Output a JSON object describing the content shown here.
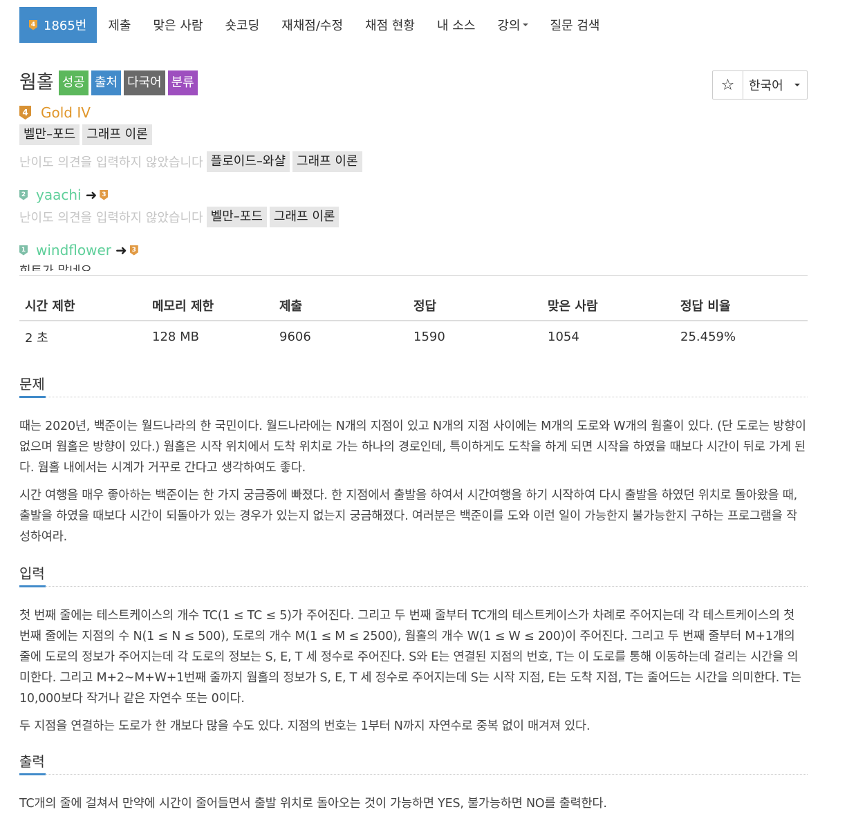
{
  "nav": {
    "problem_tier": "4",
    "problem_number": "1865번",
    "tabs": [
      "제출",
      "맞은 사람",
      "숏코딩",
      "재채점/수정",
      "채점 현황",
      "내 소스",
      "강의",
      "질문 검색"
    ]
  },
  "problem": {
    "title": "웜홀",
    "labels": [
      "성공",
      "출처",
      "다국어",
      "분류"
    ]
  },
  "controls": {
    "star_icon": "☆",
    "language": "한국어"
  },
  "tier": {
    "badge": "4",
    "name": "Gold IV"
  },
  "algorithm_tags": [
    "벨만–포드",
    "그래프 이론"
  ],
  "opinions": [
    {
      "difficulty_note": "난이도 의견을 입력하지 않았습니다",
      "tags": [
        "플로이드–와샬",
        "그래프 이론"
      ]
    },
    {
      "from_badge": "2",
      "user": "yaachi",
      "arrow": "➜",
      "to_badge": "3",
      "difficulty_note": "난이도 의견을 입력하지 않았습니다",
      "tags": [
        "벨만–포드",
        "그래프 이론"
      ]
    },
    {
      "from_badge": "1",
      "user": "windflower",
      "arrow": "➜",
      "to_badge": "3",
      "clipped_text": "힌트가 많네요"
    }
  ],
  "stats": {
    "headers": [
      "시간 제한",
      "메모리 제한",
      "제출",
      "정답",
      "맞은 사람",
      "정답 비율"
    ],
    "values": [
      "2 초",
      "128 MB",
      "9606",
      "1590",
      "1054",
      "25.459%"
    ]
  },
  "sections": {
    "problem": {
      "heading": "문제",
      "paragraphs": [
        "때는 2020년, 백준이는 월드나라의 한 국민이다. 월드나라에는 N개의 지점이 있고 N개의 지점 사이에는 M개의 도로와 W개의 웜홀이 있다. (단 도로는 방향이 없으며 웜홀은 방향이 있다.) 웜홀은 시작 위치에서 도착 위치로 가는 하나의 경로인데, 특이하게도 도착을 하게 되면 시작을 하였을 때보다 시간이 뒤로 가게 된다. 웜홀 내에서는 시계가 거꾸로 간다고 생각하여도 좋다.",
        "시간 여행을 매우 좋아하는 백준이는 한 가지 궁금증에 빠졌다. 한 지점에서 출발을 하여서 시간여행을 하기 시작하여 다시 출발을 하였던 위치로 돌아왔을 때, 출발을 하였을 때보다 시간이 되돌아가 있는 경우가 있는지 없는지 궁금해졌다. 여러분은 백준이를 도와 이런 일이 가능한지 불가능한지 구하는 프로그램을 작성하여라."
      ]
    },
    "input": {
      "heading": "입력",
      "paragraphs": [
        "첫 번째 줄에는 테스트케이스의 개수 TC(1 ≤ TC ≤ 5)가 주어진다. 그리고 두 번째 줄부터 TC개의 테스트케이스가 차례로 주어지는데 각 테스트케이스의 첫 번째 줄에는 지점의 수 N(1 ≤ N ≤ 500), 도로의 개수 M(1 ≤ M ≤ 2500), 웜홀의 개수 W(1 ≤ W ≤ 200)이 주어진다. 그리고 두 번째 줄부터 M+1개의 줄에 도로의 정보가 주어지는데 각 도로의 정보는 S, E, T 세 정수로 주어진다. S와 E는 연결된 지점의 번호, T는 이 도로를 통해 이동하는데 걸리는 시간을 의미한다. 그리고 M+2~M+W+1번째 줄까지 웜홀의 정보가 S, E, T 세 정수로 주어지는데 S는 시작 지점, E는 도착 지점, T는 줄어드는 시간을 의미한다. T는 10,000보다 작거나 같은 자연수 또는 0이다.",
        "두 지점을 연결하는 도로가 한 개보다 많을 수도 있다. 지점의 번호는 1부터 N까지 자연수로 중복 없이 매겨져 있다."
      ]
    },
    "output": {
      "heading": "출력",
      "paragraphs": [
        "TC개의 줄에 걸쳐서 만약에 시간이 줄어들면서 출발 위치로 돌아오는 것이 가능하면 YES, 불가능하면 NO를 출력한다."
      ]
    }
  },
  "colors": {
    "primary": "#428bca",
    "success": "#5cb85c",
    "gray_label": "#6a6a6a",
    "purple_label": "#9e4fbf",
    "gold_tier": "#e0962a",
    "username": "#5fcf9a"
  }
}
